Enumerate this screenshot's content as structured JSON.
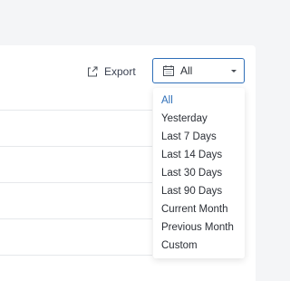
{
  "toolbar": {
    "export_label": "Export",
    "export_icon": "export-icon"
  },
  "date_filter": {
    "selected_value": "All",
    "icon": "calendar-icon",
    "accent_color": "#2f6fb8",
    "options": [
      "All",
      "Yesterday",
      "Last 7 Days",
      "Last 14 Days",
      "Last 30 Days",
      "Last 90 Days",
      "Current Month",
      "Previous Month",
      "Custom"
    ]
  }
}
